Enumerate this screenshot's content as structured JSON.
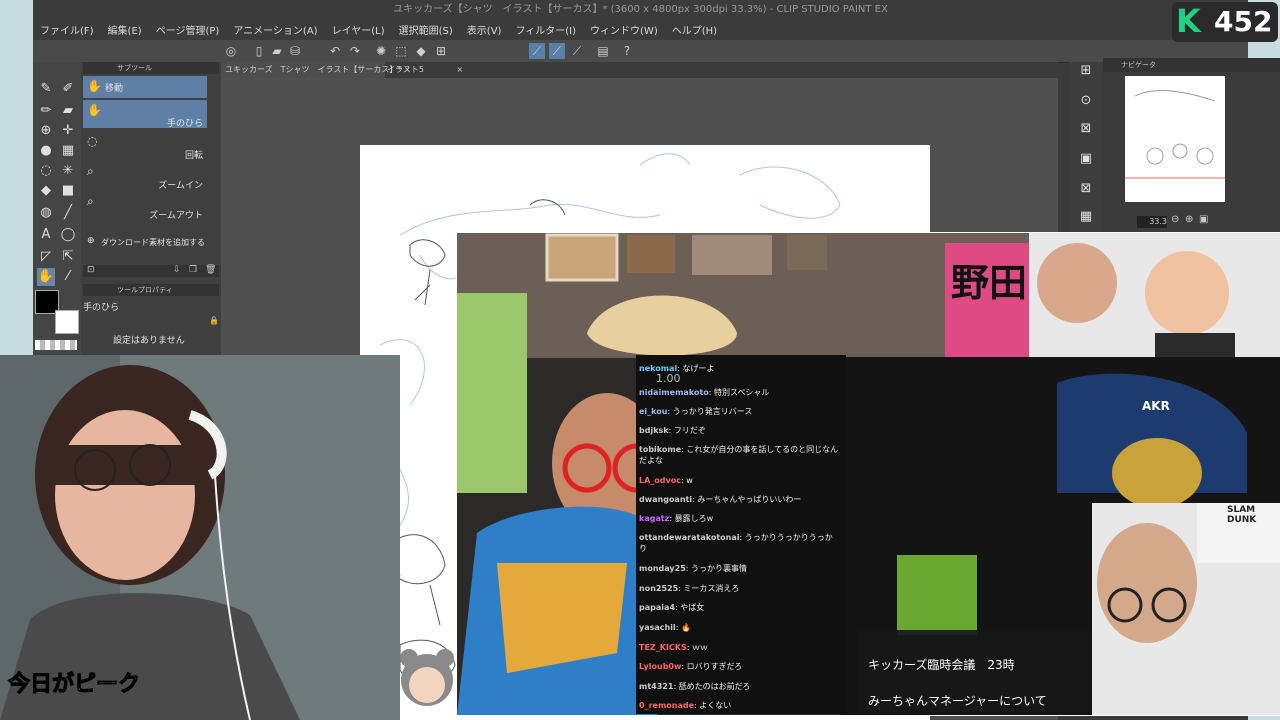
{
  "app": {
    "title": "ユキッカーズ【シャツ　イラスト【サーカス】* (3600 x 4800px 300dpi 33.3%) - CLIP STUDIO PAINT EX",
    "menu": [
      "ファイル(F)",
      "編集(E)",
      "ページ管理(P)",
      "アニメーション(A)",
      "レイヤー(L)",
      "選択範囲(S)",
      "表示(V)",
      "フィルター(I)",
      "ウィンドウ(W)",
      "ヘルプ(H)"
    ],
    "tabs": [
      "ユキッカーズ　Tシャツ　イラスト【サーカス】*",
      "イラスト5"
    ],
    "subtool": {
      "header": "サブツール",
      "items": [
        "移動",
        "手のひら",
        "回転",
        "ズームイン",
        "ズームアウト"
      ],
      "add_material": "ダウンロード素材を追加する"
    },
    "tool_property": {
      "header": "ツールプロパティ",
      "tool_name": "手のひら",
      "no_settings": "設定はありません"
    },
    "navigator": {
      "header": "ナビゲータ",
      "zoom": "33.3"
    }
  },
  "viewer_count": "452",
  "stream": {
    "chat_top_value": "1.00",
    "banner_text": "野田",
    "chat": [
      {
        "user": "nekomal",
        "msg": "なげーよ"
      },
      {
        "user": "nidaimemakoto",
        "msg": "特別スペシャル"
      },
      {
        "user": "ei_kou",
        "msg": "うっかり発言リバース"
      },
      {
        "user": "bdjksk",
        "msg": "フリだぞ"
      },
      {
        "user": "tobikome",
        "msg": "これ女が自分の事を話してるのと同じなんだよな"
      },
      {
        "user": "LA_odvoc",
        "msg": "w"
      },
      {
        "user": "dwangoanti",
        "msg": "みーちゃんやっぱりいいわー"
      },
      {
        "user": "kagatz",
        "msg": "暴露しろw"
      },
      {
        "user": "ottandewaratakotonai",
        "msg": "うっかりうっかりうっかり"
      },
      {
        "user": "monday25",
        "msg": "うっかり裏事情"
      },
      {
        "user": "non2525",
        "msg": "ミーカス消えろ"
      },
      {
        "user": "papaia4",
        "msg": "やば女"
      },
      {
        "user": "yasachil",
        "msg": "🔥"
      },
      {
        "user": "TEZ_KICKS",
        "msg": "ｗｗ"
      },
      {
        "user": "Lyloub0w",
        "msg": "ロバりすぎだろ"
      },
      {
        "user": "mt4321",
        "msg": "舐めたのはお前だろ"
      },
      {
        "user": "0_remonade",
        "msg": "よくない"
      }
    ],
    "caption_line1": "キッカーズ臨時会議　23時",
    "caption_line2": "みーちゃんマネージャーについて",
    "poster_text": "SLAM DUNK",
    "chair_text": "AKR"
  },
  "bottom_caption": "今日がピーク"
}
